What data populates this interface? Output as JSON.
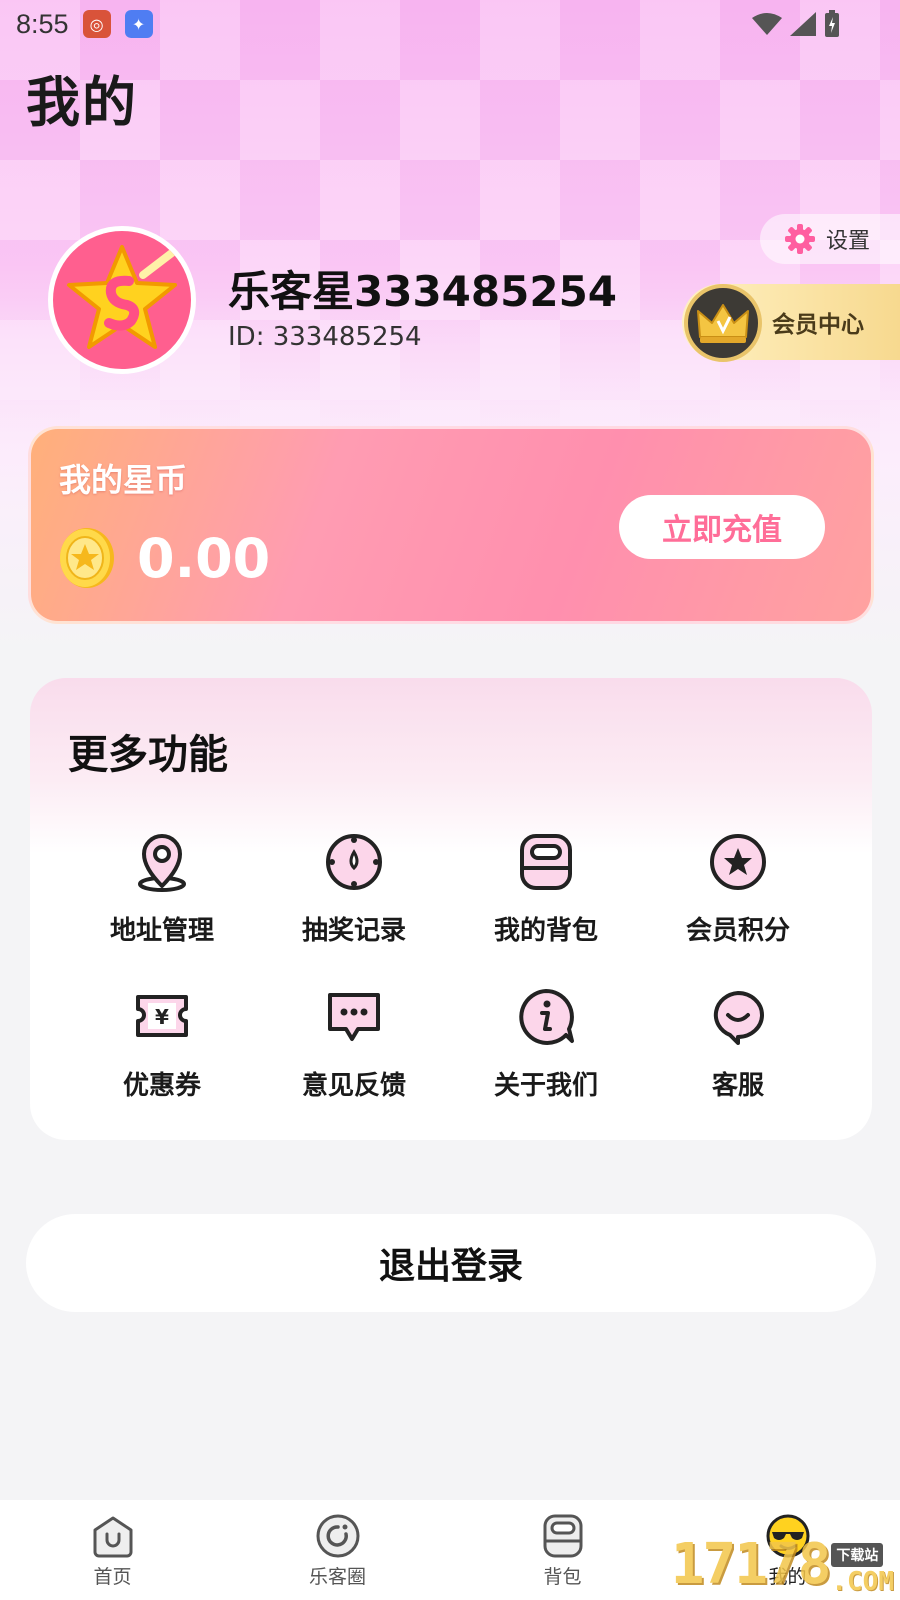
{
  "status_bar": {
    "time": "8:55"
  },
  "header": {
    "title": "我的",
    "settings_label": "设置"
  },
  "profile": {
    "username": "乐客星333485254",
    "id_text": "ID: 333485254",
    "vip_label": "会员中心"
  },
  "coins": {
    "title": "我的星币",
    "value": "0.00",
    "recharge_label": "立即充值"
  },
  "features": {
    "title": "更多功能",
    "items": [
      {
        "label": "地址管理",
        "icon": "location-pin-icon"
      },
      {
        "label": "抽奖记录",
        "icon": "lottery-icon"
      },
      {
        "label": "我的背包",
        "icon": "backpack-icon"
      },
      {
        "label": "会员积分",
        "icon": "star-badge-icon"
      },
      {
        "label": "优惠券",
        "icon": "coupon-icon"
      },
      {
        "label": "意见反馈",
        "icon": "feedback-icon"
      },
      {
        "label": "关于我们",
        "icon": "info-icon"
      },
      {
        "label": "客服",
        "icon": "customer-service-icon"
      }
    ]
  },
  "logout_label": "退出登录",
  "tabs": [
    {
      "label": "首页",
      "icon": "home-icon"
    },
    {
      "label": "乐客圈",
      "icon": "circle-icon"
    },
    {
      "label": "背包",
      "icon": "bag-icon"
    },
    {
      "label": "我的",
      "icon": "profile-face-icon",
      "active": true
    }
  ],
  "watermark": {
    "number": "17178",
    "tag": "下载站",
    "suffix": ".COM"
  },
  "colors": {
    "accent_pink": "#ff6d98",
    "coin_gradient_start": "#ffb07a",
    "coin_gradient_end": "#ff8fae",
    "gold": "#f7d98f"
  }
}
